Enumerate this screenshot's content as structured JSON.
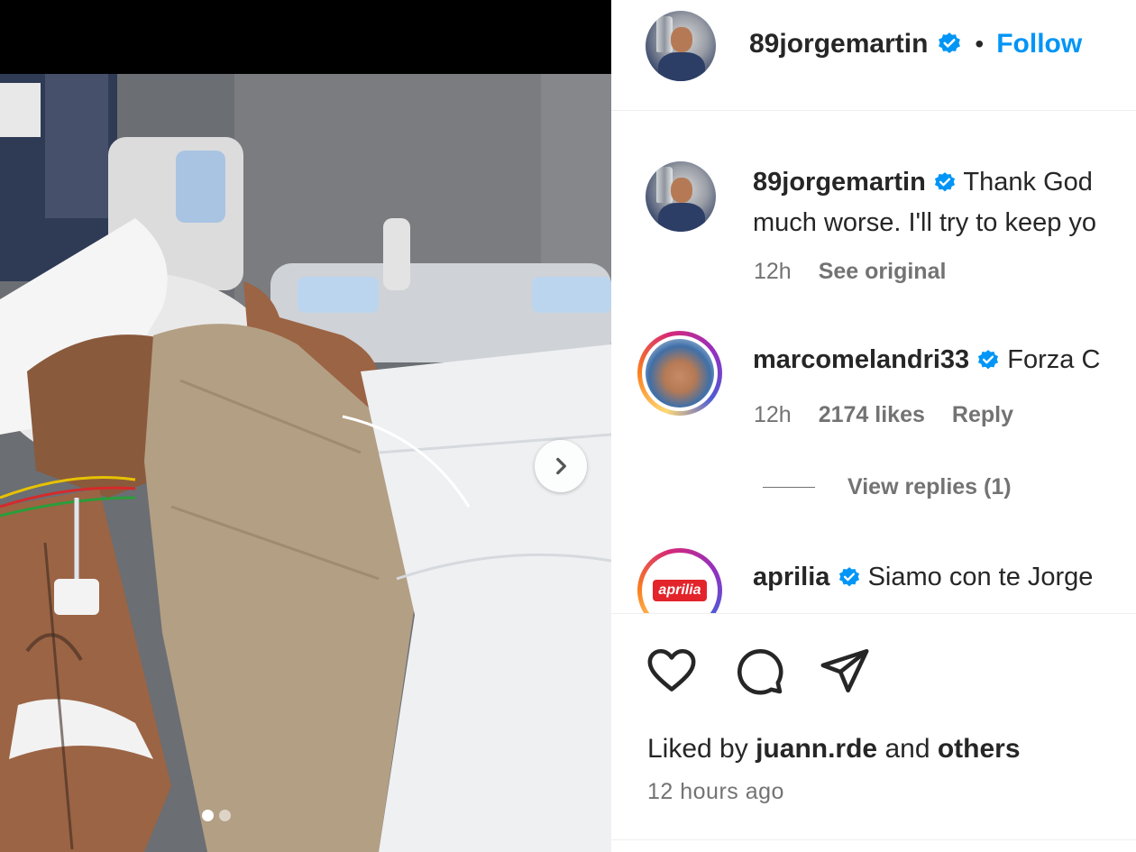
{
  "post": {
    "author": "89jorgemartin",
    "follow_label": "Follow",
    "separator": "•",
    "media_dots": 2,
    "media_active_index": 0
  },
  "comments": [
    {
      "username": "89jorgemartin",
      "verified": true,
      "text_line1": "Thank God",
      "text_line2": "much worse. I'll try to keep yo",
      "time": "12h",
      "action": "See original"
    },
    {
      "username": "marcomelandri33",
      "verified": true,
      "text_line1": "Forza C",
      "time": "12h",
      "likes": "2174 likes",
      "action": "Reply",
      "view_replies": "View replies (1)"
    },
    {
      "username": "aprilia",
      "verified": true,
      "text_line1": "Siamo con te Jorge",
      "avatar_text": "aprilia"
    }
  ],
  "likes": {
    "prefix": "Liked by",
    "user": "juann.rde",
    "and": "and",
    "others": "others"
  },
  "timestamp": "12 hours ago",
  "colors": {
    "link": "#0095f6",
    "verified": "#0095f6",
    "text": "#262626",
    "muted": "#737373",
    "aprilia_red": "#e3242b"
  },
  "icons": [
    "verified-badge-icon",
    "chevron-right-icon",
    "heart-icon",
    "comment-icon",
    "share-icon"
  ]
}
